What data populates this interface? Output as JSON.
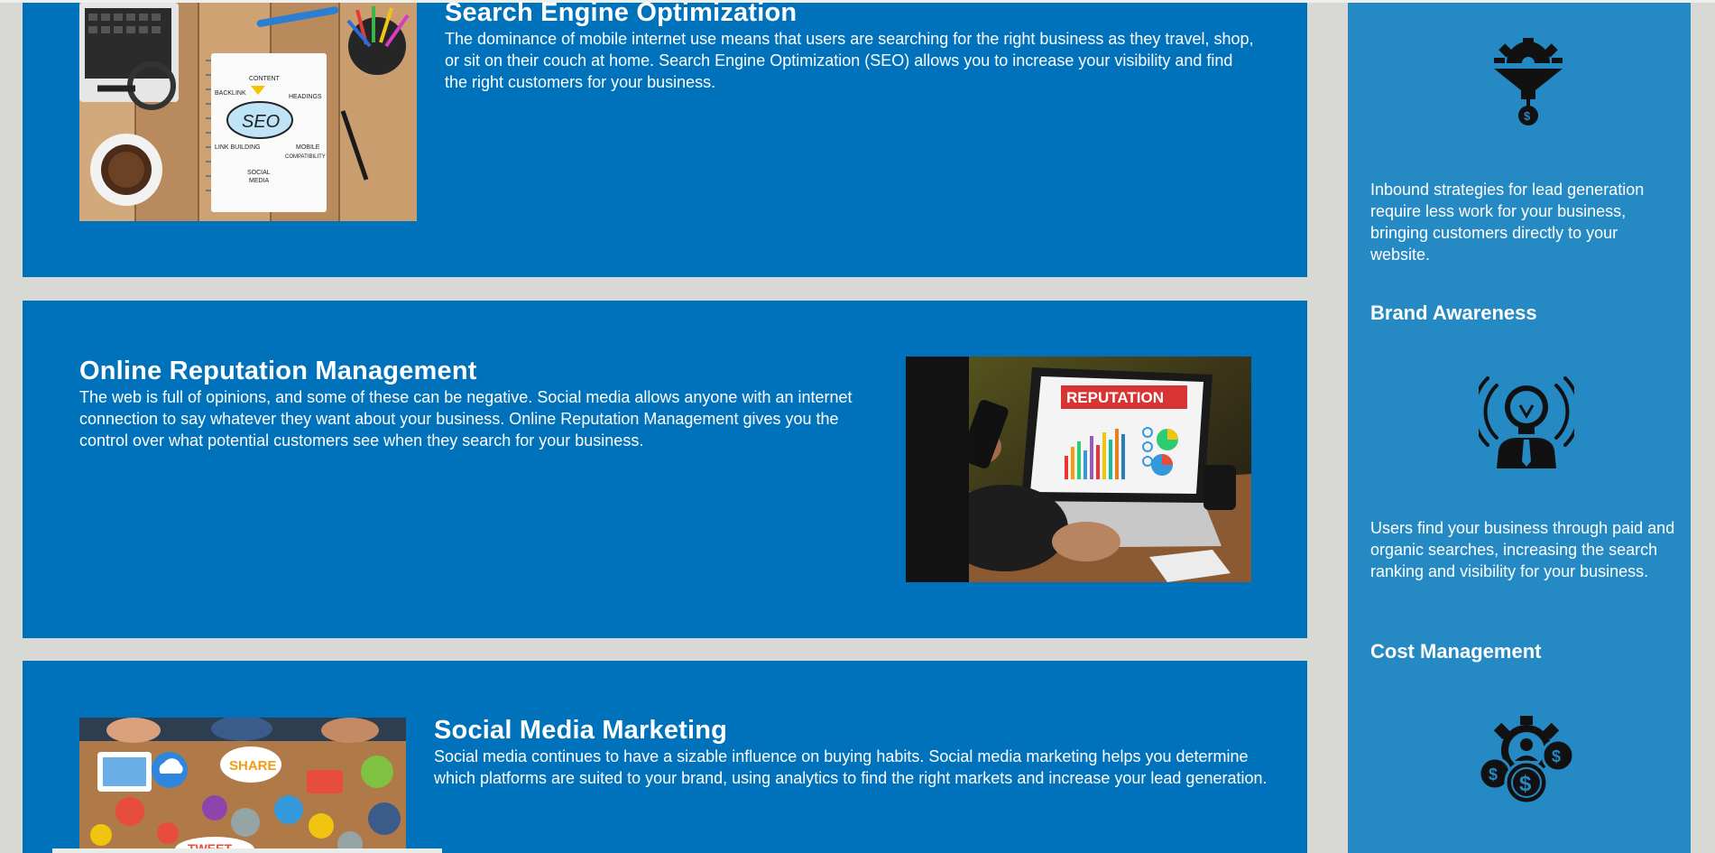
{
  "services": {
    "seo": {
      "title": "Search Engine Optimization",
      "description": "The dominance of mobile internet use means that users are searching for the right business as they travel, shop, or sit on their couch at home. Search Engine Optimization (SEO) allows you to increase your visibility and find the right customers for your business.",
      "image_labels": {
        "seo": "SEO",
        "content": "CONTENT",
        "backlink": "BACKLINK",
        "headings": "HEADINGS",
        "link_building": "LINK BUILDING",
        "mobile": "MOBILE",
        "compatibility": "COMPATIBILITY",
        "social": "SOCIAL",
        "media": "MEDIA"
      }
    },
    "orm": {
      "title": "Online Reputation Management",
      "description": "The web is full of opinions, and some of these can be negative. Social media allows anyone with an internet connection to say whatever they want about your business. Online Reputation Management gives you the control over what potential customers see when they search for your business.",
      "image_label": "REPUTATION"
    },
    "smm": {
      "title": "Social Media Marketing",
      "description": "Social media continues to have a sizable influence on buying habits. Social media marketing helps you determine which platforms are suited to your brand, using analytics to find the right markets and increase your lead generation.",
      "image_labels": {
        "share": "SHARE",
        "tweet": "TWEET"
      }
    }
  },
  "benefits": {
    "lead": {
      "icon": "gear-funnel-money-icon",
      "text": "Inbound strategies for lead generation require less work for your business, bringing customers directly to your website."
    },
    "brand": {
      "title": "Brand Awareness",
      "icon": "lightbulb-person-icon",
      "text": "Users find your business through paid and organic searches, increasing the search ranking and visibility for your business."
    },
    "cost": {
      "title": "Cost Management",
      "icon": "gear-coins-icon"
    }
  },
  "colors": {
    "page_background": "#d8d9d4",
    "card_background": "#0072bc",
    "aside_background": "#2589c4",
    "text": "#ffffff"
  }
}
